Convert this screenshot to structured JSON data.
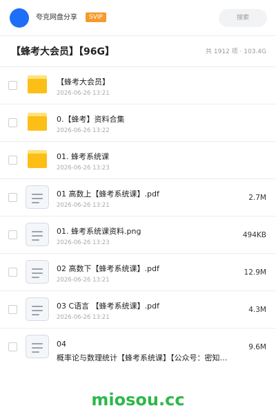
{
  "header": {
    "app_name": "夸克网盘分享",
    "badge": "SVIP",
    "search_placeholder": "搜索"
  },
  "folder": {
    "title": "【蜂考大会员】【96G】",
    "meta": "共 1912 项 · 103.4G"
  },
  "files": [
    {
      "type": "folder",
      "name": "【蜂考大会员】",
      "date": "2026-06-26 13:21",
      "size": ""
    },
    {
      "type": "folder",
      "name": "0.【蜂考】资料合集",
      "date": "2026-06-26 13:22",
      "size": ""
    },
    {
      "type": "folder",
      "name": "01. 蜂考系统课",
      "date": "2026-06-26 13:23",
      "size": ""
    },
    {
      "type": "doc",
      "name": "01 高数上【蜂考系统课】.pdf",
      "date": "2026-06-26 13:21",
      "size": "2.7M"
    },
    {
      "type": "doc",
      "name": "01. 蜂考系统课资料.png",
      "date": "2026-06-26 13:23",
      "size": "494KB"
    },
    {
      "type": "doc",
      "name": "02 高数下【蜂考系统课】.pdf",
      "date": "2026-06-26 13:21",
      "size": "12.9M"
    },
    {
      "type": "doc",
      "name": "03 C语言 【蜂考系统课】.pdf",
      "date": "2026-06-26 13:21",
      "size": "4.3M"
    },
    {
      "type": "doc",
      "name": "04",
      "name_line2": "概率论与数理统计【蜂考系统课】【公众号：密知…",
      "date": "",
      "size": "9.6M"
    }
  ],
  "watermark": "miosou.cc",
  "colors": {
    "accent": "#1e6ff7",
    "svip": "#f59a2b",
    "folder": "#fcbf17",
    "watermark": "#2eb84a"
  }
}
